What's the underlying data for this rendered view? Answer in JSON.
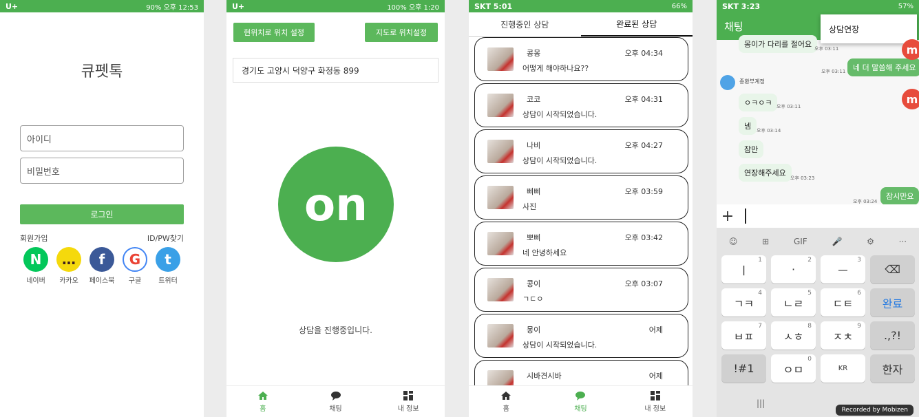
{
  "screen1": {
    "status_left": "U+",
    "status_right": "90% 오후 12:53",
    "title": "큐펫톡",
    "id_placeholder": "아이디",
    "pw_placeholder": "비밀번호",
    "login": "로그인",
    "signup": "회원가입",
    "find": "ID/PW찾기",
    "socials": [
      {
        "icon": "N",
        "label": "네이버",
        "color": "#03c75a"
      },
      {
        "icon": "…",
        "label": "카카오",
        "color": "#f5d90c"
      },
      {
        "icon": "f",
        "label": "페이스북",
        "color": "#3b5998"
      },
      {
        "icon": "G",
        "label": "구글",
        "color": "#ffffff"
      },
      {
        "icon": "t",
        "label": "트위터",
        "color": "#3aa0e7"
      }
    ]
  },
  "screen2": {
    "status_left": "U+",
    "status_right": "100% 오후 1:20",
    "btn_current": "현위치로 위치 설정",
    "btn_map": "지도로 위치설정",
    "address": "경기도 고양시 덕양구 화정동 899",
    "on_label": "on",
    "message": "상담을 진행중입니다.",
    "nav": [
      "홈",
      "채팅",
      "내 정보"
    ]
  },
  "screen3": {
    "status_left": "SKT 5:01",
    "status_right": "66%",
    "tab_ongoing": "진행중인 상담",
    "tab_done": "완료된 상담",
    "items": [
      {
        "name": "콩몽",
        "time": "오후 04:34",
        "last": "어떻게 해야하나요??"
      },
      {
        "name": "코코",
        "time": "오후 04:31",
        "last": "상담이 시작되었습니다."
      },
      {
        "name": "나비",
        "time": "오후 04:27",
        "last": "상담이 시작되었습니다."
      },
      {
        "name": "삐삐",
        "time": "오후 03:59",
        "last": "사진"
      },
      {
        "name": "뽀삐",
        "time": "오후 03:42",
        "last": "네 안녕하세요"
      },
      {
        "name": "콩이",
        "time": "오후 03:07",
        "last": "ㄱㄷㅇ"
      },
      {
        "name": "몽이",
        "time": "어제",
        "last": "상담이 시작되었습니다."
      },
      {
        "name": "시바견시바",
        "time": "어제",
        "last": ""
      }
    ],
    "nav": [
      "홈",
      "채팅",
      "내 정보"
    ]
  },
  "screen4": {
    "status_left": "SKT 3:23",
    "status_right": "57%",
    "title": "채팅",
    "menu_item": "상담연장",
    "sender": "종환부계정",
    "messages": [
      {
        "text": "몽이가 다리를 절어요",
        "dir": "in",
        "time": "오후 03:11"
      },
      {
        "text": "네 더 말씀해 주세요",
        "dir": "out",
        "time": "오후 03:11"
      },
      {
        "text": "ㅇㅋㅇㅋ",
        "dir": "in",
        "time": "오후 03:11"
      },
      {
        "text": "넴",
        "dir": "in",
        "time": "오후 03:14"
      },
      {
        "text": "잠만",
        "dir": "in",
        "time": ""
      },
      {
        "text": "연장해주세요",
        "dir": "in",
        "time": "오후 03:23"
      },
      {
        "text": "잠시만요",
        "dir": "out",
        "time": "오후 03:24"
      }
    ],
    "keys": [
      {
        "label": "ㅣ",
        "n": "1"
      },
      {
        "label": "·",
        "n": "2"
      },
      {
        "label": "ㅡ",
        "n": "3"
      },
      {
        "label": "⌫",
        "n": ""
      },
      {
        "label": "ㄱㅋ",
        "n": "4"
      },
      {
        "label": "ㄴㄹ",
        "n": "5"
      },
      {
        "label": "ㄷㅌ",
        "n": "6"
      },
      {
        "label": "완료",
        "n": ""
      },
      {
        "label": "ㅂㅍ",
        "n": "7"
      },
      {
        "label": "ㅅㅎ",
        "n": "8"
      },
      {
        "label": "ㅈㅊ",
        "n": "9"
      },
      {
        "label": ".,?!",
        "n": ""
      },
      {
        "label": "!#1",
        "n": ""
      },
      {
        "label": "ㅇㅁ",
        "n": "0"
      },
      {
        "label": "KR",
        "n": ""
      },
      {
        "label": "한자",
        "n": ""
      }
    ],
    "kb_tools": [
      "☺",
      "⊞",
      "GIF",
      "🎤",
      "⚙",
      "···"
    ],
    "recorded": "Recorded by Mobizen"
  }
}
